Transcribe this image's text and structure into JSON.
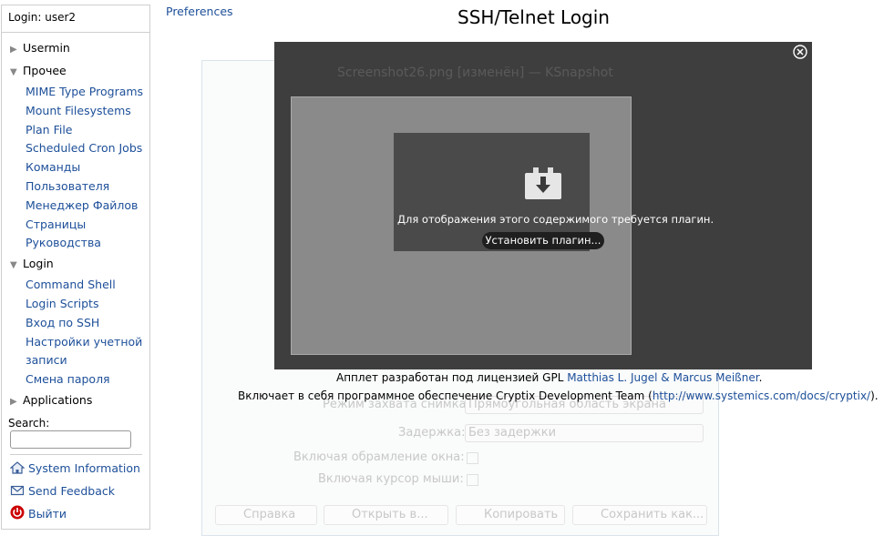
{
  "sidebar": {
    "login_text": "Login: user2",
    "categories": [
      {
        "label": "Usermin",
        "expanded": false
      },
      {
        "label": "Прочее",
        "expanded": true,
        "items": [
          "MIME Type Programs",
          "Mount Filesystems",
          "Plan File",
          "Scheduled Cron Jobs",
          "Команды",
          "Пользователя",
          "Менеджер Файлов",
          "Страницы",
          "Руководства"
        ]
      },
      {
        "label": "Login",
        "expanded": true,
        "items": [
          "Command Shell",
          "Login Scripts",
          "Вход по SSH",
          "Настройки учетной",
          "записи",
          "Смена пароля"
        ]
      },
      {
        "label": "Applications",
        "expanded": false
      }
    ],
    "search_label": "Search:",
    "search_value": "",
    "bottom_links": [
      "System Information",
      "Send Feedback",
      "Выйти"
    ]
  },
  "main": {
    "preferences_label": "Preferences",
    "title": "SSH/Telnet Login",
    "applet": {
      "plugin_message": "Для отображения этого содержимого требуется плагин.",
      "install_button": "Установить плагин..."
    },
    "ghost_window": {
      "title": "Screenshot26.png [изменён] — KSnapshot",
      "capture_mode_label": "Режим захвата снимка:",
      "capture_mode_value": "Прямоугольная область экрана",
      "delay_label": "Задержка:",
      "delay_value": "Без задержки",
      "include_border_label": "Включая обрамление окна:",
      "include_cursor_label": "Включая курсор мыши:",
      "buttons": [
        "Справка",
        "Открыть в...",
        "Копировать",
        "Сохранить как..."
      ]
    },
    "credits": {
      "line1_prefix": "Апплет разработан под лицензией GPL ",
      "line1_link": "Matthias L. Jugel & Marcus Meißner",
      "line1_suffix": ".",
      "line2_prefix": "Включает в себя программное обеспечение Cryptix Development Team (",
      "line2_link": "http://www.systemics.com/docs/cryptix/",
      "line2_suffix": ")."
    }
  },
  "colors": {
    "link": "#1d4f99",
    "applet_bg": "#3e3e3e",
    "logout_icon": "#cc0000"
  },
  "icons": {
    "collapsed": "triangle-right-icon",
    "expanded": "triangle-down-icon",
    "system_information": "house-icon",
    "send_feedback": "envelope-icon",
    "logout": "power-icon",
    "plugin": "download-plugin-icon",
    "close": "close-circle-icon"
  }
}
